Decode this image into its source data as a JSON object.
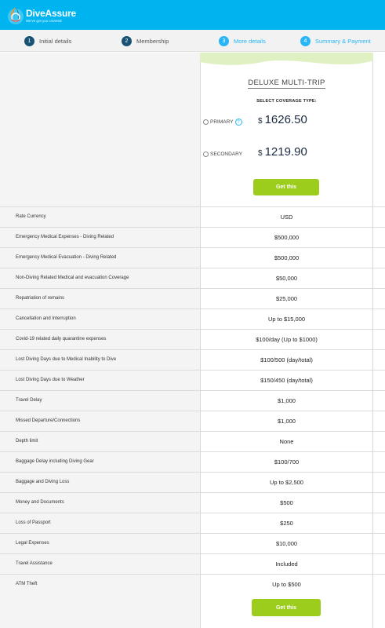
{
  "brand": {
    "name": "DiveAssure",
    "tagline": "We've got you covered",
    "color": "#00b5ef"
  },
  "steps": [
    {
      "num": "1",
      "label": "Initial details",
      "state": "done"
    },
    {
      "num": "2",
      "label": "Membership",
      "state": "done"
    },
    {
      "num": "3",
      "label": "More details",
      "state": "todo"
    },
    {
      "num": "4",
      "label": "Summary & Payment",
      "state": "todo"
    }
  ],
  "plan": {
    "name": "DELUXE MULTI-TRIP",
    "coverage_label": "SELECT COVERAGE TYPE:",
    "primary": {
      "label": "PRIMARY",
      "help": "?",
      "currency_symbol": "$",
      "price": "1626.50"
    },
    "secondary": {
      "label": "SECONDARY",
      "currency_symbol": "$",
      "price": "1219.90"
    },
    "cta_top": "Get this",
    "cta_bottom": "Get this"
  },
  "benefits": [
    {
      "label": "Rate Currency",
      "value": "USD"
    },
    {
      "label": "Emergency Medical Expenses - Diving Related",
      "value": "$500,000"
    },
    {
      "label": "Emergency Medical Evacuation - Diving Related",
      "value": "$500,000"
    },
    {
      "label": "Non-Diving Related Medical and evacuation Coverage",
      "value": "$50,000"
    },
    {
      "label": "Repatriation of remains",
      "value": "$25,000"
    },
    {
      "label": "Cancellation and Interruption",
      "value": "Up to $15,000"
    },
    {
      "label": "Covid-19 related daily quarantine expenses",
      "value": "$100/day (Up to $1000)"
    },
    {
      "label": "Lost Diving Days due to Medical Inability to Dive",
      "value": "$100/500 (day/total)"
    },
    {
      "label": "Lost Diving Days due to Weather",
      "value": "$150/450 (day/total)"
    },
    {
      "label": "Travel Delay",
      "value": "$1,000"
    },
    {
      "label": "Missed Departure/Connections",
      "value": "$1,000"
    },
    {
      "label": "Depth limit",
      "value": "None"
    },
    {
      "label": "Baggage Delay including Diving Gear",
      "value": "$100/700"
    },
    {
      "label": "Baggage and Diving Loss",
      "value": "Up to $2,500"
    },
    {
      "label": "Money and Documents",
      "value": "$500"
    },
    {
      "label": "Loss of Passport",
      "value": "$250"
    },
    {
      "label": "Legal Expenses",
      "value": "$10,000"
    },
    {
      "label": "Travel Assistance",
      "value": "Included"
    },
    {
      "label": "ATM Theft",
      "value": "Up to $500"
    }
  ],
  "colors": {
    "header": "#00b5ef",
    "accent_green": "#9ccc1c",
    "step_done": "#1a5276",
    "step_todo": "#29b6f6"
  }
}
